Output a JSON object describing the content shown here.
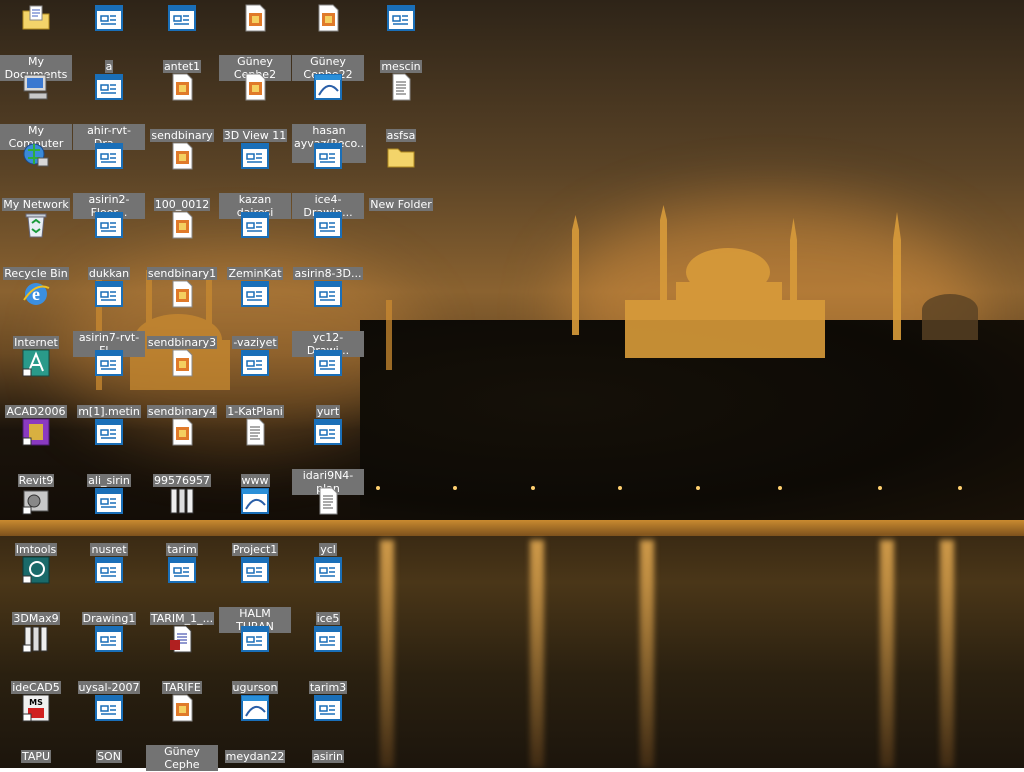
{
  "desktop": {
    "icons": [
      {
        "id": "my-documents",
        "label": "My Documents",
        "type": "folder-docs",
        "col": 0,
        "row": 0
      },
      {
        "id": "a",
        "label": "a",
        "type": "dwg",
        "col": 1,
        "row": 0
      },
      {
        "id": "antet1",
        "label": "antet1",
        "type": "dwg",
        "col": 2,
        "row": 0
      },
      {
        "id": "guney-cephe2",
        "label": "Güney Cephe2",
        "type": "image",
        "col": 3,
        "row": 0
      },
      {
        "id": "guney-cephe22",
        "label": "Güney Cephe22",
        "type": "image",
        "col": 4,
        "row": 0
      },
      {
        "id": "mescin",
        "label": "mescin",
        "type": "dwg",
        "col": 5,
        "row": 0
      },
      {
        "id": "my-computer",
        "label": "My Computer",
        "type": "computer",
        "col": 0,
        "row": 1
      },
      {
        "id": "ahir-rvt",
        "label": "ahir-rvt-Dra...",
        "type": "dwg",
        "col": 1,
        "row": 1
      },
      {
        "id": "sendbinary",
        "label": "sendbinary",
        "type": "image",
        "col": 2,
        "row": 1
      },
      {
        "id": "3d-view-11",
        "label": "3D View 11",
        "type": "image",
        "col": 3,
        "row": 1
      },
      {
        "id": "hasan-ayvaz",
        "label": "hasan ayvaz(Reco...",
        "type": "dwf",
        "col": 4,
        "row": 1
      },
      {
        "id": "asfsa",
        "label": "asfsa",
        "type": "text",
        "col": 5,
        "row": 1
      },
      {
        "id": "my-network",
        "label": "My Network",
        "type": "network",
        "col": 0,
        "row": 2
      },
      {
        "id": "asirin2-floor",
        "label": "asirin2-Floor...",
        "type": "dwg",
        "col": 1,
        "row": 2
      },
      {
        "id": "100-0012",
        "label": "100_0012",
        "type": "image",
        "col": 2,
        "row": 2
      },
      {
        "id": "kazan-dairesi",
        "label": "kazan dairesi",
        "type": "dwg",
        "col": 3,
        "row": 2
      },
      {
        "id": "ice4-drawing",
        "label": "ice4-Drawin...",
        "type": "dwg",
        "col": 4,
        "row": 2
      },
      {
        "id": "new-folder",
        "label": "New Folder",
        "type": "folder",
        "col": 5,
        "row": 2
      },
      {
        "id": "recycle-bin",
        "label": "Recycle Bin",
        "type": "recycle",
        "col": 0,
        "row": 3
      },
      {
        "id": "dukkan",
        "label": "dukkan",
        "type": "dwg",
        "col": 1,
        "row": 3
      },
      {
        "id": "sendbinary1",
        "label": "sendbinary1",
        "type": "image",
        "col": 2,
        "row": 3
      },
      {
        "id": "zeminkat",
        "label": "ZeminKat",
        "type": "dwg",
        "col": 3,
        "row": 3
      },
      {
        "id": "asirin8-3d",
        "label": "asirin8-3D...",
        "type": "dwg",
        "col": 4,
        "row": 3
      },
      {
        "id": "internet",
        "label": "Internet",
        "type": "ie",
        "col": 0,
        "row": 4
      },
      {
        "id": "asirin7-rvt",
        "label": "asirin7-rvt-Fl...",
        "type": "dwg",
        "col": 1,
        "row": 4
      },
      {
        "id": "sendbinary3",
        "label": "sendbinary3",
        "type": "image",
        "col": 2,
        "row": 4
      },
      {
        "id": "vaziyet",
        "label": "-vaziyet",
        "type": "dwg",
        "col": 3,
        "row": 4
      },
      {
        "id": "yc12-drawing",
        "label": "yc12-Drawi...",
        "type": "dwg",
        "col": 4,
        "row": 4
      },
      {
        "id": "acad2006",
        "label": "ACAD2006",
        "type": "acad",
        "col": 0,
        "row": 5
      },
      {
        "id": "m1-metin",
        "label": "m[1].metin",
        "type": "dwg",
        "col": 1,
        "row": 5
      },
      {
        "id": "sendbinary4",
        "label": "sendbinary4",
        "type": "image",
        "col": 2,
        "row": 5
      },
      {
        "id": "1-katplani",
        "label": "1-KatPlani",
        "type": "dwg",
        "col": 3,
        "row": 5
      },
      {
        "id": "yurt",
        "label": "yurt",
        "type": "dwg",
        "col": 4,
        "row": 5
      },
      {
        "id": "revit9",
        "label": "Revit9",
        "type": "revit",
        "col": 0,
        "row": 6
      },
      {
        "id": "ali-sirin",
        "label": "ali_sirin",
        "type": "dwg",
        "col": 1,
        "row": 6
      },
      {
        "id": "99576957",
        "label": "99576957",
        "type": "image",
        "col": 2,
        "row": 6
      },
      {
        "id": "www",
        "label": "www",
        "type": "text",
        "col": 3,
        "row": 6
      },
      {
        "id": "idari9n4-plan",
        "label": "idari9N4-plan",
        "type": "dwg",
        "col": 4,
        "row": 6
      },
      {
        "id": "imtools",
        "label": "Imtools",
        "type": "tools",
        "col": 0,
        "row": 7
      },
      {
        "id": "nusret",
        "label": "nusret",
        "type": "dwg",
        "col": 1,
        "row": 7
      },
      {
        "id": "tarim",
        "label": "tarim",
        "type": "idecad-file",
        "col": 2,
        "row": 7
      },
      {
        "id": "project1",
        "label": "Project1",
        "type": "dwf",
        "col": 3,
        "row": 7
      },
      {
        "id": "ycl",
        "label": "ycl",
        "type": "text",
        "col": 4,
        "row": 7
      },
      {
        "id": "3dmax9",
        "label": "3DMax9",
        "type": "max",
        "col": 0,
        "row": 8
      },
      {
        "id": "drawing1",
        "label": "Drawing1",
        "type": "dwg",
        "col": 1,
        "row": 8
      },
      {
        "id": "tarim-1",
        "label": "TARIM_1_...",
        "type": "dwg",
        "col": 2,
        "row": 8
      },
      {
        "id": "halm-turan",
        "label": "HALM TURAN",
        "type": "dwg",
        "col": 3,
        "row": 8
      },
      {
        "id": "ice5",
        "label": "ice5",
        "type": "dwg",
        "col": 4,
        "row": 8
      },
      {
        "id": "idecad5",
        "label": "ideCAD5",
        "type": "idecad",
        "col": 0,
        "row": 9
      },
      {
        "id": "uysal-2007",
        "label": "uysal-2007",
        "type": "dwg",
        "col": 1,
        "row": 9
      },
      {
        "id": "tarife",
        "label": "TARIFE",
        "type": "doc",
        "col": 2,
        "row": 9
      },
      {
        "id": "ugurson",
        "label": "ugurson",
        "type": "dwg",
        "col": 3,
        "row": 9
      },
      {
        "id": "tarim3",
        "label": "tarim3",
        "type": "dwg",
        "col": 4,
        "row": 9
      },
      {
        "id": "tapu",
        "label": "TAPU",
        "type": "msproject",
        "col": 0,
        "row": 10
      },
      {
        "id": "son",
        "label": "SON",
        "type": "dwg",
        "col": 1,
        "row": 10
      },
      {
        "id": "guney-cephe",
        "label": "Güney Cephe",
        "type": "image",
        "col": 2,
        "row": 10
      },
      {
        "id": "meydan22",
        "label": "meydan22",
        "type": "dwf",
        "col": 3,
        "row": 10
      },
      {
        "id": "asirin",
        "label": "asirin",
        "type": "dwg",
        "col": 4,
        "row": 10
      }
    ]
  },
  "colors": {
    "label_bg": "#737373",
    "label_text": "#ffffff",
    "dwg_blue": "#1a6fb8",
    "image_orange": "#e07a2a"
  }
}
